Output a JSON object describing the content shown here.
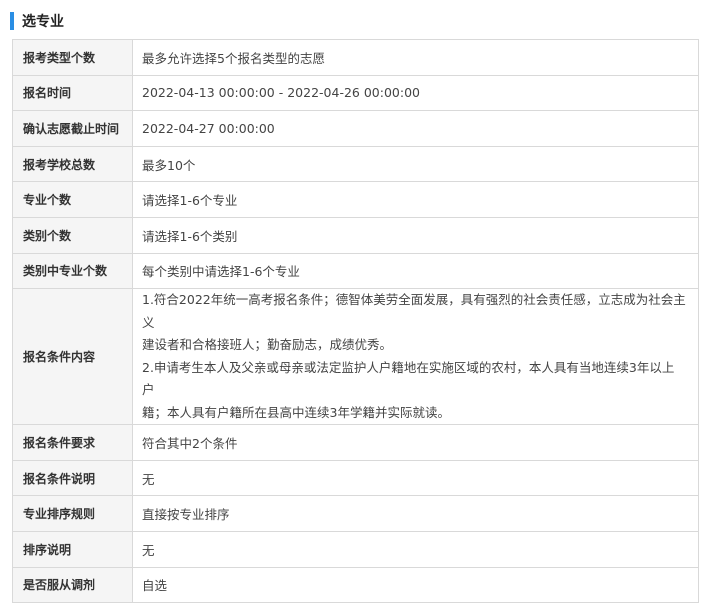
{
  "section": {
    "title": "选专业"
  },
  "rows": [
    {
      "label": "报考类型个数",
      "value": "最多允许选择5个报名类型的志愿"
    },
    {
      "label": "报名时间",
      "value": "2022-04-13 00:00:00 - 2022-04-26 00:00:00"
    },
    {
      "label": "确认志愿截止时间",
      "value": "2022-04-27 00:00:00"
    },
    {
      "label": "报考学校总数",
      "value": "最多10个"
    },
    {
      "label": "专业个数",
      "value": "请选择1-6个专业"
    },
    {
      "label": "类别个数",
      "value": "请选择1-6个类别"
    },
    {
      "label": "类别中专业个数",
      "value": "每个类别中请选择1-6个专业"
    },
    {
      "label": "报名条件内容",
      "lines": [
        "1.符合2022年统一高考报名条件；德智体美劳全面发展，具有强烈的社会责任感，立志成为社会主义",
        "建设者和合格接班人；勤奋励志，成绩优秀。",
        "2.申请考生本人及父亲或母亲或法定监护人户籍地在实施区域的农村，本人具有当地连续3年以上户",
        "籍；本人具有户籍所在县高中连续3年学籍并实际就读。"
      ]
    },
    {
      "label": "报名条件要求",
      "value": "符合其中2个条件"
    },
    {
      "label": "报名条件说明",
      "value": "无"
    },
    {
      "label": "专业排序规则",
      "value": "直接按专业排序"
    },
    {
      "label": "排序说明",
      "value": "无"
    },
    {
      "label": "是否服从调剂",
      "value": "自选"
    }
  ]
}
